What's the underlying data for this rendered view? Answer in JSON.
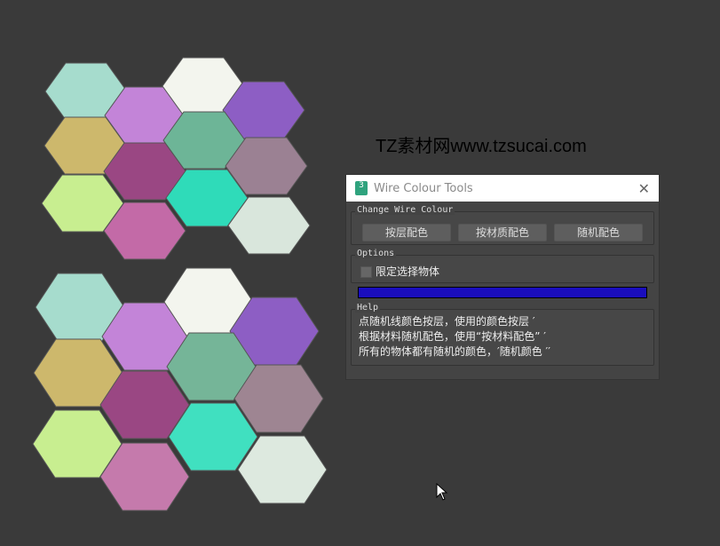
{
  "watermark": "TZ素材网www.tzsucai.com",
  "dialog": {
    "title": "Wire Colour Tools",
    "icon_label": "3",
    "change_group": {
      "label": "Change Wire Colour",
      "buttons": [
        "按层配色",
        "按材质配色",
        "随机配色"
      ]
    },
    "options_group": {
      "label": "Options",
      "checkbox_label": "限定选择物体",
      "checked": false
    },
    "progress": 1.0,
    "progress_color": "#1a0dbd",
    "help_group": {
      "label": "Help",
      "lines": [
        "点随机线颜色按层，使用的颜色按层 ′",
        "根据材料随机配色，使用“按材料配色” ′",
        "所有的物体都有随机的颜色，′随机颜色 ′′"
      ]
    }
  },
  "hex_colors": [
    "#a6dccd",
    "#c384d8",
    "#f3f5ee",
    "#8d5ec4",
    "#cdb86c",
    "#9a4783",
    "#6db597",
    "#9b8193",
    "#c8ee90",
    "#c36aa7",
    "#2fdbb9",
    "#d9e6dc"
  ],
  "hex_colors_bottom": [
    "#a6dccd",
    "#c384d8",
    "#f3f5ee",
    "#8d5ec4",
    "#cdb86c",
    "#9a4783",
    "#75b598",
    "#9e8592",
    "#c8ee90",
    "#c57aac",
    "#40e0c0",
    "#dde9df"
  ]
}
